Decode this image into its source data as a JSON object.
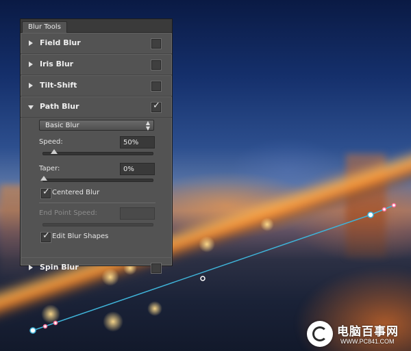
{
  "panel": {
    "tab": "Blur Tools",
    "sections": {
      "field_blur": {
        "title": "Field Blur",
        "expanded": false,
        "enabled": false
      },
      "iris_blur": {
        "title": "Iris Blur",
        "expanded": false,
        "enabled": false
      },
      "tilt_shift": {
        "title": "Tilt-Shift",
        "expanded": false,
        "enabled": false
      },
      "path_blur": {
        "title": "Path Blur",
        "expanded": true,
        "enabled": true
      },
      "spin_blur": {
        "title": "Spin Blur",
        "expanded": false,
        "enabled": false
      }
    },
    "path_blur": {
      "mode": "Basic Blur",
      "speed_label": "Speed:",
      "speed_value": "50%",
      "speed_level": 0.1,
      "taper_label": "Taper:",
      "taper_value": "0%",
      "taper_level": 0.0,
      "centered_blur_label": "Centered Blur",
      "centered_blur_checked": true,
      "end_point_speed_label": "End Point Speed:",
      "end_point_speed_value": "",
      "edit_blur_shapes_label": "Edit Blur Shapes",
      "edit_blur_shapes_checked": true
    }
  },
  "blur_path": {
    "color": "#3fb3d8",
    "handle_color": "#ffffff",
    "endpoint_marker_color": "#ff6f9a"
  },
  "watermark": {
    "brand": "电脑百事网",
    "url": "WWW.PC841.COM"
  }
}
